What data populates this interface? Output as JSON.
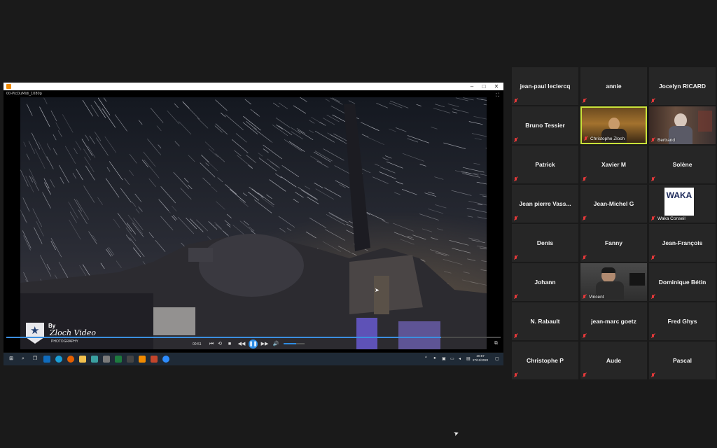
{
  "shared_screen": {
    "player": {
      "filename": "00-PicDuMidi_1080p",
      "window_buttons": [
        "–",
        "□",
        "✕"
      ],
      "current_time": "00:51",
      "progress": 0.88,
      "volume": 0.6,
      "watermark": {
        "line1": "By",
        "line2": "Zloch Video",
        "line3": "PHOTOGRAPHY"
      },
      "controls": [
        "⏮",
        "⟲",
        "■",
        "◀◀",
        "▶▶",
        "🔊"
      ]
    },
    "taskbar": {
      "clock_time": "20:57",
      "clock_date": "27/11/2020",
      "icons": [
        "start-icon",
        "search-icon",
        "task-view-icon",
        "outlook-icon",
        "edge-icon",
        "firefox-icon",
        "file-explorer-icon",
        "app-icon",
        "app-icon",
        "excel-icon",
        "app-icon",
        "vlc-icon",
        "app-icon",
        "zoom-icon"
      ]
    }
  },
  "gallery": {
    "participants": [
      {
        "name": "jean-paul leclercq",
        "video": false
      },
      {
        "name": "annie",
        "video": false
      },
      {
        "name": "Jocelyn RICARD",
        "video": false
      },
      {
        "name": "Bruno Tessier",
        "video": false
      },
      {
        "name": "Christophe Zloch",
        "video": true,
        "active": true
      },
      {
        "name": "Bertrand",
        "video": true
      },
      {
        "name": "Patrick",
        "video": false
      },
      {
        "name": "Xavier M",
        "video": false
      },
      {
        "name": "Solène",
        "video": false
      },
      {
        "name": "Jean pierre Vass...",
        "video": false
      },
      {
        "name": "Jean-Michel G",
        "video": false
      },
      {
        "name": "Waka Conseil",
        "video": true,
        "logo_text": "WAKA"
      },
      {
        "name": "Denis",
        "video": false
      },
      {
        "name": "Fanny",
        "video": false
      },
      {
        "name": "Jean-François",
        "video": false
      },
      {
        "name": "Johann",
        "video": false
      },
      {
        "name": "Vincent",
        "video": true
      },
      {
        "name": "Dominique Bétin",
        "video": false
      },
      {
        "name": "N. Rabault",
        "video": false
      },
      {
        "name": "jean-marc goetz",
        "video": false
      },
      {
        "name": "Fred Ghys",
        "video": false
      },
      {
        "name": "Christophe P",
        "video": false
      },
      {
        "name": "Aude",
        "video": false
      },
      {
        "name": "Pascal",
        "video": false
      }
    ]
  },
  "colors": {
    "background": "#1a1a1a",
    "tile": "#262626",
    "active_speaker_border": "#c9e23a",
    "muted_mic": "#e5393a",
    "player_accent": "#2f8de4"
  }
}
